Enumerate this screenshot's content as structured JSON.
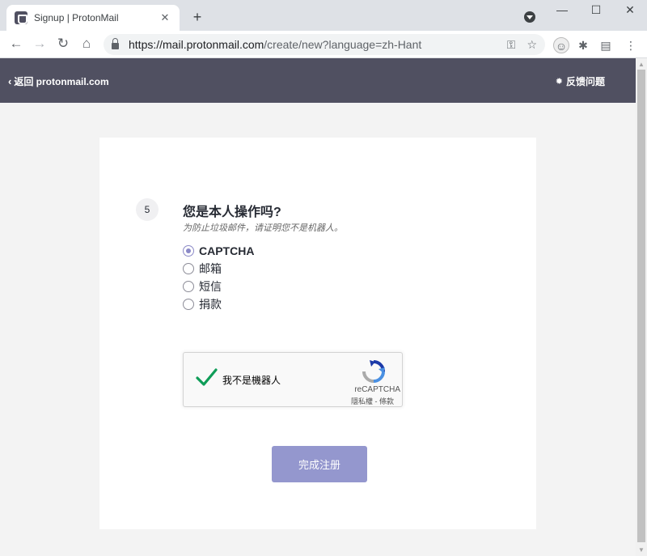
{
  "browser": {
    "tab_title": "Signup | ProtonMail",
    "tab_close": "✕",
    "new_tab": "+",
    "url_host": "https://mail.protonmail.com",
    "url_rest": "/create/new?language=zh-Hant",
    "window_controls": {
      "minimize": "—",
      "maximize": "☐",
      "close": "✕"
    },
    "nav": {
      "back": "←",
      "forward": "→",
      "reload": "↻",
      "home": "⌂"
    },
    "icons": [
      "key-icon",
      "star-icon",
      "extension-avatar-icon",
      "puzzle-icon",
      "extension-icon",
      "menu-icon"
    ]
  },
  "header": {
    "back_label": "返回 protonmail.com",
    "feedback_label": "反馈问题"
  },
  "step": {
    "number": "5",
    "title": "您是本人操作吗?",
    "hint": "为防止垃圾邮件，请证明您不是机器人。"
  },
  "options": [
    {
      "label": "CAPTCHA",
      "selected": true
    },
    {
      "label": "邮箱",
      "selected": false
    },
    {
      "label": "短信",
      "selected": false
    },
    {
      "label": "捐款",
      "selected": false
    }
  ],
  "recaptcha": {
    "label": "我不是機器人",
    "brand": "reCAPTCHA",
    "privacy": "隱私權",
    "separator": " - ",
    "terms": "條款"
  },
  "submit_label": "完成注册",
  "colors": {
    "header_bg": "#505061",
    "accent": "#9497ce",
    "check_green": "#0f9d58"
  }
}
